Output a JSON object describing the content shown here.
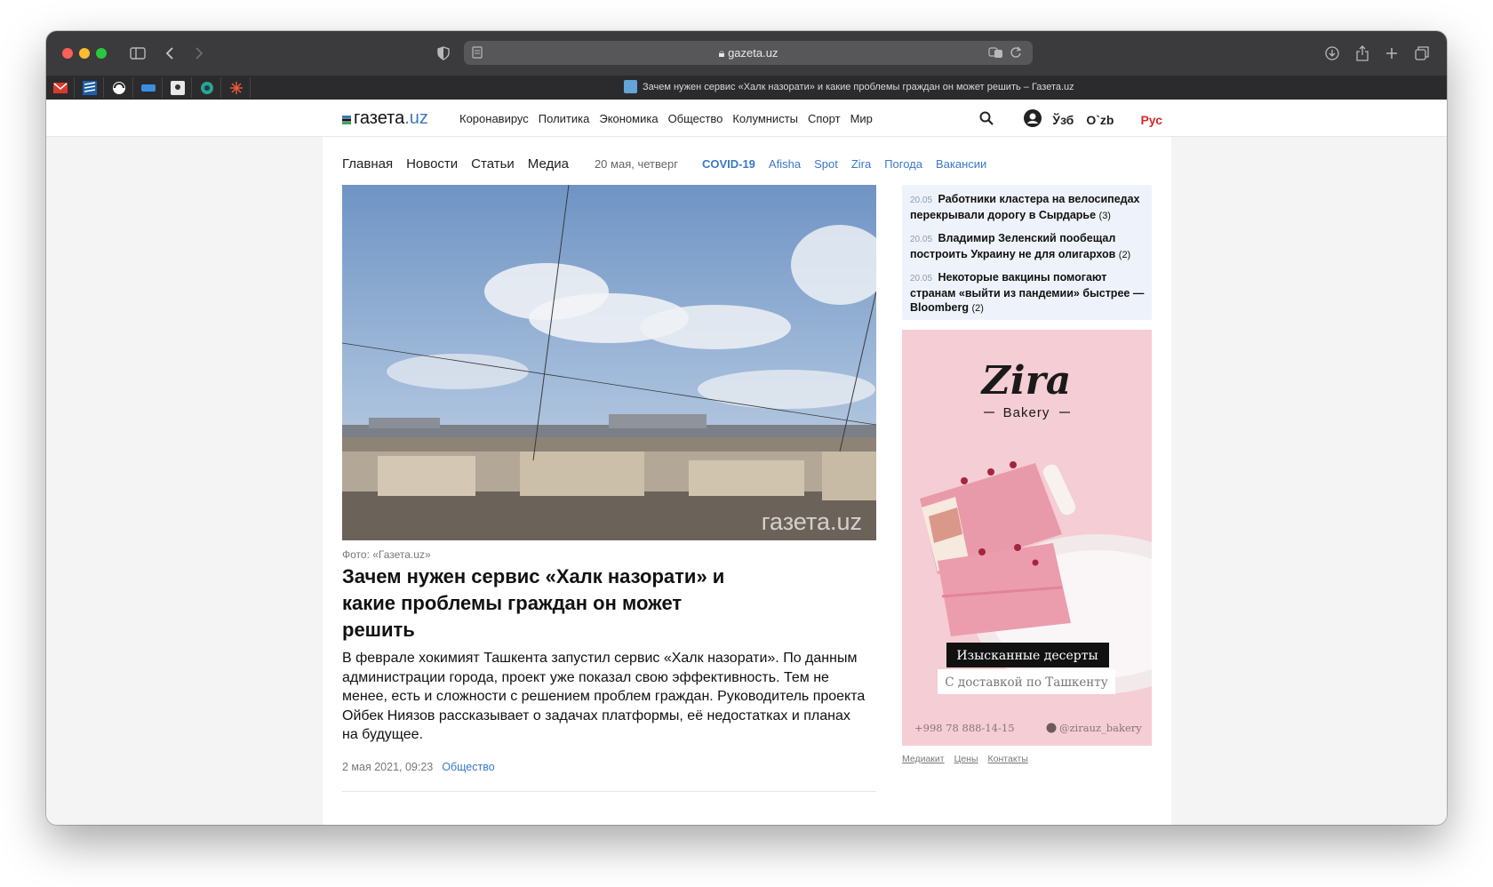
{
  "browser": {
    "url": "gazeta.uz",
    "tab_title": "Зачем нужен сервис «Халк назорати» и какие проблемы граждан он может решить – Газета.uz"
  },
  "site": {
    "logo_main": "газета",
    "logo_suffix": ".uz",
    "topnav": [
      "Коронавирус",
      "Политика",
      "Экономика",
      "Общество",
      "Колумнисты",
      "Спорт",
      "Мир"
    ],
    "lang": [
      "Ўзб",
      "O`zb",
      "Рус"
    ],
    "active_lang_color": "#d62c2c"
  },
  "subnav": {
    "main": [
      "Главная",
      "Новости",
      "Статьи",
      "Медиа"
    ],
    "date": "20 мая, четверг",
    "links": [
      "COVID-19",
      "Afisha",
      "Spot",
      "Zira",
      "Погода",
      "Вакансии"
    ]
  },
  "article": {
    "watermark": "газета.uz",
    "caption": "Фото: «Газета.uz»",
    "headline": "Зачем нужен сервис «Халк назорати» и какие проблемы граждан он может решить",
    "lead": "В феврале хокимият Ташкента запустил сервис «Халк назорати». По данным администрации города, проект уже показал свою эффективность. Тем не менее, есть и сложности с решением проблем граждан. Руководитель проекта Ойбек Ниязов рассказывает о задачах платформы, её недостатках и планах на будущее.",
    "date": "2 мая 2021, 09:23",
    "category": "Общество"
  },
  "news": [
    {
      "time": "20.05",
      "title": "Работники кластера на велосипедах перекрывали дорогу в Сырдарье",
      "comments": "(3)"
    },
    {
      "time": "20.05",
      "title": "Владимир Зеленский пообещал построить Украину не для олигархов",
      "comments": "(2)"
    },
    {
      "time": "20.05",
      "title": "Некоторые вакцины помогают странам «выйти из пандемии» быстрее — Bloomberg",
      "comments": "(2)"
    }
  ],
  "ad": {
    "brand": "Zira",
    "sub": "Bakery",
    "tagline1": "Изысканные десерты",
    "tagline2": "С доставкой по Ташкенту",
    "phone": "+998 78 888-14-15",
    "handle": "@zirauz_bakery"
  },
  "footer_links": [
    "Медиакит",
    "Цены",
    "Контакты"
  ]
}
